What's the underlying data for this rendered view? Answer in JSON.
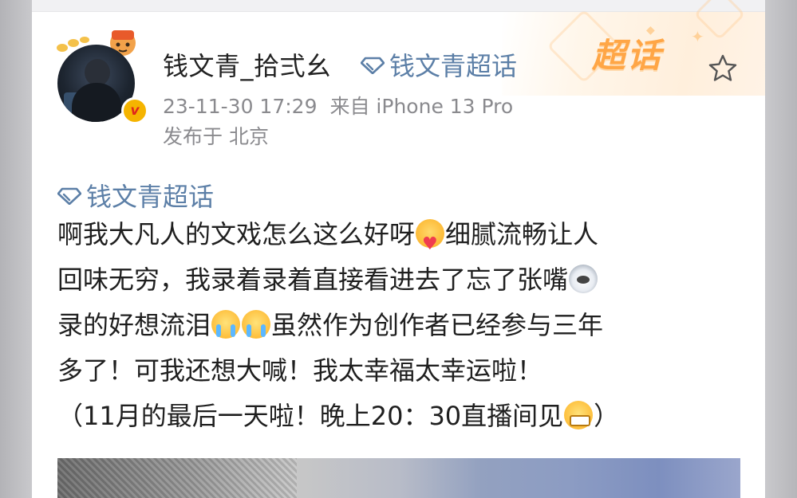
{
  "post": {
    "author": "钱文青_拾弍幺",
    "topic_link": "钱文青超话",
    "timestamp": "23-11-30 17:29",
    "source": "来自 iPhone 13 Pro",
    "location": "发布于 北京",
    "badge_letter": "v",
    "super_topic_logo": "超话",
    "body_topic": "钱文青超话",
    "lines": [
      [
        "啊我大凡人的文戏怎么这么好呀",
        "细腻流畅让人"
      ],
      [
        "回味无穷，我录着录着直接看进去了忘了张嘴",
        ""
      ],
      [
        "录的好想流泪",
        "",
        "虽然作为创作者已经参与三年"
      ],
      [
        "多了！可我还想大喊！我太幸福太幸运啦！"
      ],
      [
        "（11月的最后一天啦！晚上20：30直播间见",
        "）"
      ]
    ]
  },
  "icons": {
    "favorite": "star-outline-icon",
    "topic": "diamond-icon",
    "emojis": [
      "love-emoji",
      "husky-emoji",
      "crying-emoji",
      "crying-emoji",
      "grin-emoji"
    ]
  },
  "colors": {
    "topic_link": "#5c7fa7",
    "super_logo": "#ffa646",
    "meta_text": "#8a8a8e",
    "badge": "#f5b400"
  }
}
